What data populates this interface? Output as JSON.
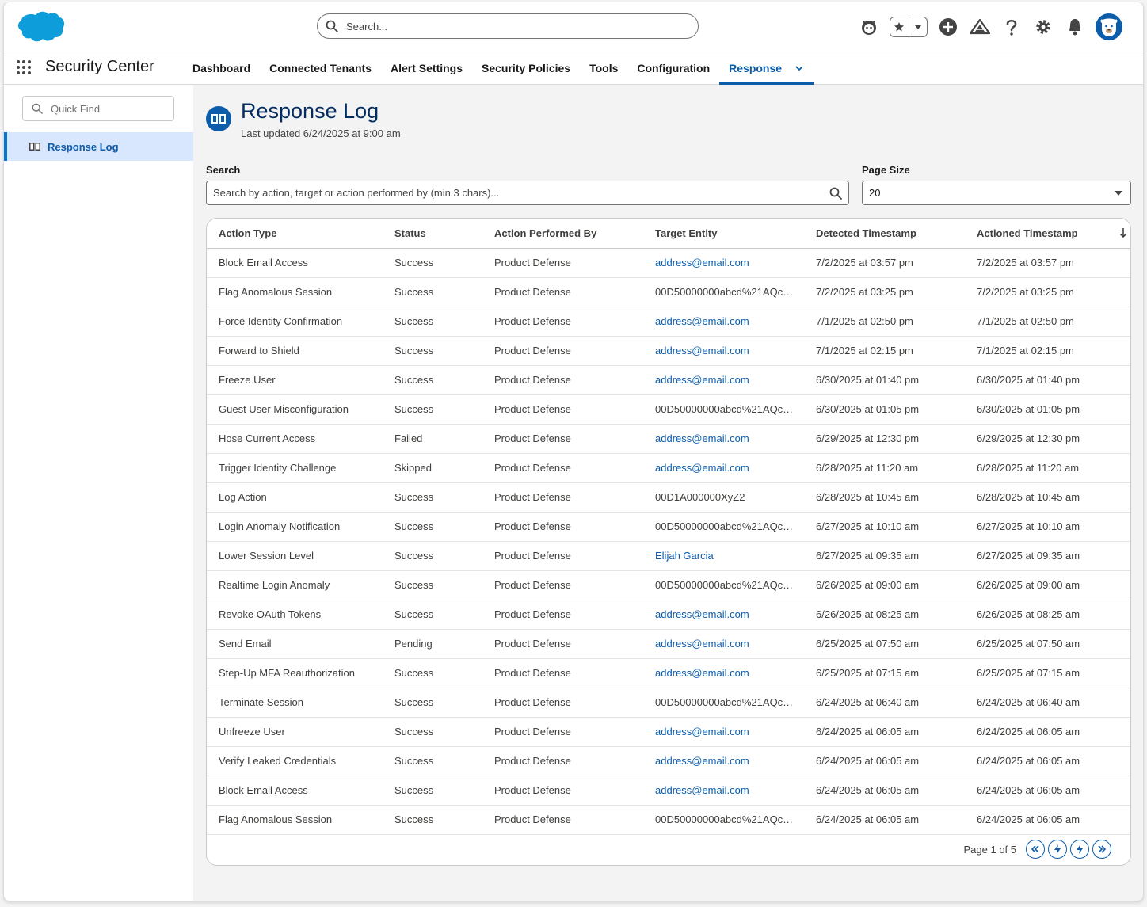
{
  "header": {
    "search_placeholder": "Search...",
    "icons": [
      "einstein-icon",
      "favorites-star-icon",
      "favorites-dropdown-icon",
      "add-icon",
      "trailhead-icon",
      "help-icon",
      "setup-gear-icon",
      "notifications-bell-icon",
      "user-avatar"
    ],
    "brand_color": "#0176d3"
  },
  "nav": {
    "app_name": "Security Center",
    "tabs": [
      {
        "label": "Dashboard"
      },
      {
        "label": "Connected Tenants"
      },
      {
        "label": "Alert Settings"
      },
      {
        "label": "Security Policies"
      },
      {
        "label": "Tools"
      },
      {
        "label": "Configuration"
      },
      {
        "label": "Response"
      }
    ],
    "active_tab": "Response"
  },
  "sidebar": {
    "quick_find_placeholder": "Quick Find",
    "items": [
      {
        "label": "Response Log",
        "icon": "book-icon"
      }
    ]
  },
  "page": {
    "title": "Response Log",
    "subtitle": "Last updated 6/24/2025 at 9:00 am",
    "search_label": "Search",
    "search_placeholder": "Search by action, target or action performed by (min 3 chars)...",
    "page_size_label": "Page Size",
    "page_size_value": "20"
  },
  "table": {
    "columns": [
      "Action Type",
      "Status",
      "Action Performed By",
      "Target Entity",
      "Detected Timestamp",
      "Actioned Timestamp"
    ],
    "rows": [
      [
        "Block Email Access",
        "Success",
        "Product Defense",
        "address@email.com",
        "7/2/2025 at 03:57 pm",
        "7/2/2025 at 03:57 pm"
      ],
      [
        "Flag Anomalous Session",
        "Success",
        "Product Defense",
        "00D50000000abcd%21AQc…",
        "7/2/2025 at 03:25 pm",
        "7/2/2025 at 03:25 pm"
      ],
      [
        "Force Identity Confirmation",
        "Success",
        "Product Defense",
        "address@email.com",
        "7/1/2025 at 02:50 pm",
        "7/1/2025 at 02:50 pm"
      ],
      [
        "Forward to Shield",
        "Success",
        "Product Defense",
        "address@email.com",
        "7/1/2025 at 02:15 pm",
        "7/1/2025 at 02:15 pm"
      ],
      [
        "Freeze User",
        "Success",
        "Product Defense",
        "address@email.com",
        "6/30/2025 at 01:40 pm",
        "6/30/2025 at 01:40 pm"
      ],
      [
        "Guest User Misconfiguration",
        "Success",
        "Product Defense",
        "00D50000000abcd%21AQc…",
        "6/30/2025 at 01:05 pm",
        "6/30/2025 at 01:05 pm"
      ],
      [
        "Hose Current Access",
        "Failed",
        "Product Defense",
        "address@email.com",
        "6/29/2025 at 12:30 pm",
        "6/29/2025 at 12:30 pm"
      ],
      [
        "Trigger Identity Challenge",
        "Skipped",
        "Product Defense",
        "address@email.com",
        "6/28/2025 at 11:20 am",
        "6/28/2025 at 11:20 am"
      ],
      [
        "Log Action",
        "Success",
        "Product Defense",
        "00D1A000000XyZ2",
        "6/28/2025 at 10:45 am",
        "6/28/2025 at 10:45 am"
      ],
      [
        "Login Anomaly Notification",
        "Success",
        "Product Defense",
        "00D50000000abcd%21AQc…",
        "6/27/2025 at 10:10 am",
        "6/27/2025 at 10:10 am"
      ],
      [
        "Lower Session Level",
        "Success",
        "Product Defense",
        "Elijah Garcia",
        "6/27/2025 at 09:35 am",
        "6/27/2025 at 09:35 am"
      ],
      [
        "Realtime Login Anomaly",
        "Success",
        "Product Defense",
        "00D50000000abcd%21AQc…",
        "6/26/2025 at 09:00 am",
        "6/26/2025 at 09:00 am"
      ],
      [
        "Revoke OAuth Tokens",
        "Success",
        "Product Defense",
        "address@email.com",
        "6/26/2025 at 08:25 am",
        "6/26/2025 at 08:25 am"
      ],
      [
        "Send Email",
        "Pending",
        "Product Defense",
        "address@email.com",
        "6/25/2025 at 07:50 am",
        "6/25/2025 at 07:50 am"
      ],
      [
        "Step-Up MFA Reauthorization",
        "Success",
        "Product Defense",
        "address@email.com",
        "6/25/2025 at 07:15 am",
        "6/25/2025 at 07:15 am"
      ],
      [
        "Terminate Session",
        "Success",
        "Product Defense",
        "00D50000000abcd%21AQc…",
        "6/24/2025 at 06:40 am",
        "6/24/2025 at 06:40 am"
      ],
      [
        "Unfreeze User",
        "Success",
        "Product Defense",
        "address@email.com",
        "6/24/2025 at 06:05 am",
        "6/24/2025 at 06:05 am"
      ],
      [
        "Verify Leaked Credentials",
        "Success",
        "Product Defense",
        "address@email.com",
        "6/24/2025 at 06:05 am",
        "6/24/2025 at 06:05 am"
      ],
      [
        "Block Email Access",
        "Success",
        "Product Defense",
        "address@email.com",
        "6/24/2025 at 06:05 am",
        "6/24/2025 at 06:05 am"
      ],
      [
        "Flag Anomalous Session",
        "Success",
        "Product Defense",
        "00D50000000abcd%21AQc…",
        "6/24/2025 at 06:05 am",
        "6/24/2025 at 06:05 am"
      ]
    ],
    "link_targets": [
      true,
      false,
      true,
      true,
      true,
      false,
      true,
      true,
      false,
      false,
      true,
      false,
      true,
      true,
      true,
      false,
      true,
      true,
      true,
      false
    ],
    "sorted_column": "Actioned Timestamp",
    "sort_direction": "descending",
    "link_color": "#0b5cab"
  },
  "pagination": {
    "label": "Page 1 of 5",
    "buttons": [
      "first-page-icon",
      "previous-page-icon",
      "next-page-icon",
      "last-page-icon"
    ]
  }
}
